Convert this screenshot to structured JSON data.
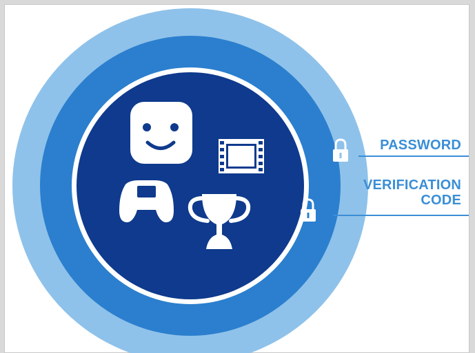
{
  "diagram": {
    "labels": {
      "password": "PASSWORD",
      "verification_code_line1": "VERIFICATION",
      "verification_code_line2": "CODE"
    },
    "colors": {
      "outer_ring": "#8fc2ea",
      "middle_ring": "#2b7fce",
      "separator_ring": "#ffffff",
      "inner_circle": "#0f3a8d",
      "label_text": "#3a8ed6",
      "icon_fill": "#ffffff"
    },
    "icons": [
      "face-icon",
      "film-strip-icon",
      "game-controller-icon",
      "trophy-icon",
      "lock-icon",
      "lock-icon"
    ]
  }
}
